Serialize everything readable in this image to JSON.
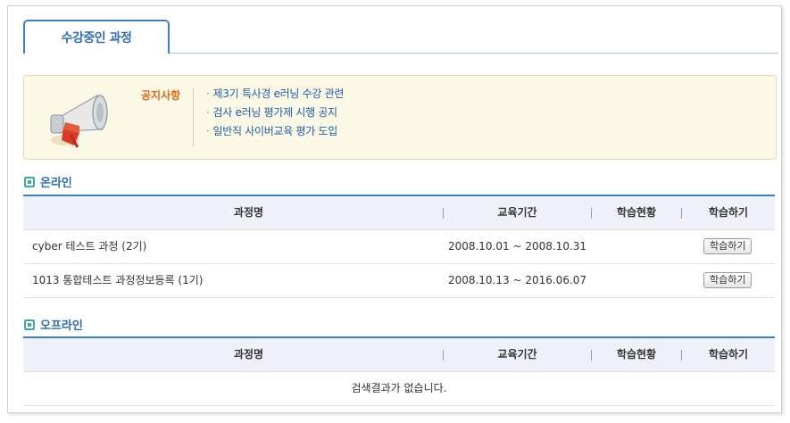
{
  "tab": {
    "label": "수강중인 과정"
  },
  "notice": {
    "title": "공지사항",
    "items": [
      "제3기 특사경 e러닝 수강 관련",
      "검사 e러닝 평가제 시행 공지",
      "일반직 사이버교육 평가 도입"
    ]
  },
  "online": {
    "heading": "온라인",
    "columns": {
      "name": "과정명",
      "period": "교육기간",
      "status": "학습현황",
      "action": "학습하기"
    },
    "rows": [
      {
        "name": "cyber 테스트 과정 (2기)",
        "period": "2008.10.01 ~ 2008.10.31",
        "status": "",
        "button": "학습하기"
      },
      {
        "name": "1013 통합테스트 과정정보등록 (1기)",
        "period": "2008.10.13 ~ 2016.06.07",
        "status": "",
        "button": "학습하기"
      }
    ]
  },
  "offline": {
    "heading": "오프라인",
    "columns": {
      "name": "과정명",
      "period": "교육기간",
      "status": "학습현황",
      "action": "학습하기"
    },
    "empty_message": "검색결과가 없습니다."
  }
}
